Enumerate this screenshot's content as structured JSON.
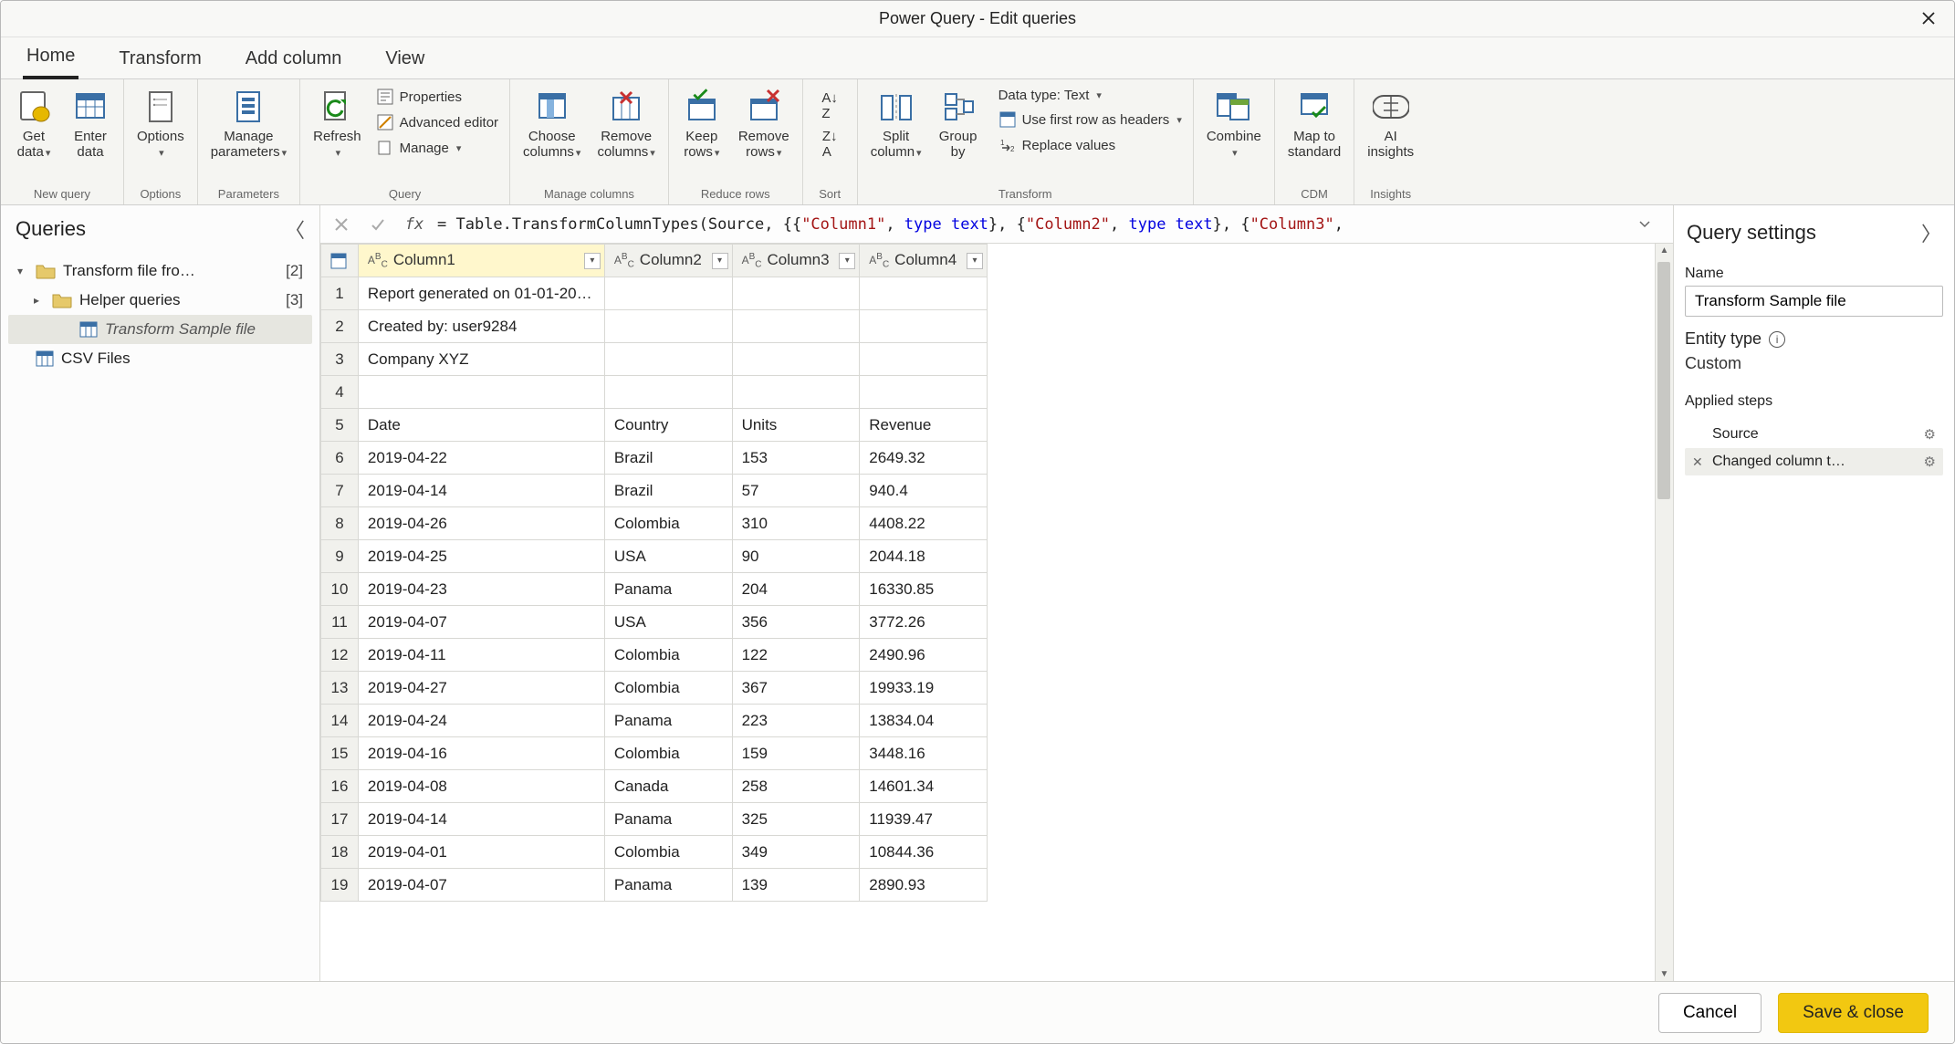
{
  "window_title": "Power Query - Edit queries",
  "maintabs": [
    "Home",
    "Transform",
    "Add column",
    "View"
  ],
  "maintab_active": 0,
  "ribbon": {
    "groups": [
      {
        "name": "New query",
        "big": [
          {
            "id": "get-data",
            "text": "Get\ndata",
            "chev": true
          },
          {
            "id": "enter-data",
            "text": "Enter\ndata"
          }
        ]
      },
      {
        "name": "Options",
        "big": [
          {
            "id": "options",
            "text": "Options",
            "chev": true
          }
        ]
      },
      {
        "name": "Parameters",
        "big": [
          {
            "id": "manage-params",
            "text": "Manage\nparameters",
            "chev": true
          }
        ]
      },
      {
        "name": "Query",
        "big": [
          {
            "id": "refresh",
            "text": "Refresh",
            "chev": true
          }
        ],
        "small": [
          {
            "id": "properties",
            "text": "Properties"
          },
          {
            "id": "adv-editor",
            "text": "Advanced editor"
          },
          {
            "id": "manage",
            "text": "Manage",
            "chev": true
          }
        ]
      },
      {
        "name": "Manage columns",
        "big": [
          {
            "id": "choose-cols",
            "text": "Choose\ncolumns",
            "chev": true
          },
          {
            "id": "remove-cols",
            "text": "Remove\ncolumns",
            "chev": true
          }
        ]
      },
      {
        "name": "Reduce rows",
        "big": [
          {
            "id": "keep-rows",
            "text": "Keep\nrows",
            "chev": true
          },
          {
            "id": "remove-rows",
            "text": "Remove\nrows",
            "chev": true
          }
        ]
      },
      {
        "name": "Sort",
        "big": [
          {
            "id": "sort",
            "text": ""
          }
        ]
      },
      {
        "name": "Transform",
        "big": [
          {
            "id": "split-col",
            "text": "Split\ncolumn",
            "chev": true
          },
          {
            "id": "group-by",
            "text": "Group\nby"
          }
        ],
        "small": [
          {
            "id": "data-type",
            "text": "Data type: Text",
            "chev": true
          },
          {
            "id": "first-row",
            "text": "Use first row as headers",
            "chev": true
          },
          {
            "id": "replace-vals",
            "text": "Replace values"
          }
        ]
      },
      {
        "name": "",
        "big": [
          {
            "id": "combine",
            "text": "Combine",
            "chev": true
          }
        ]
      },
      {
        "name": "CDM",
        "big": [
          {
            "id": "map-std",
            "text": "Map to\nstandard"
          }
        ]
      },
      {
        "name": "Insights",
        "big": [
          {
            "id": "ai-insights",
            "text": "AI\ninsights"
          }
        ]
      }
    ]
  },
  "queries": {
    "header": "Queries",
    "items": [
      {
        "id": "folder-transform",
        "label": "Transform file fro…",
        "count": "[2]",
        "type": "folder",
        "collapsed": false,
        "indent": 0,
        "caret": "down"
      },
      {
        "id": "folder-helper",
        "label": "Helper queries",
        "count": "[3]",
        "type": "folder",
        "collapsed": true,
        "indent": 1,
        "caret": "right"
      },
      {
        "id": "q-transform-sample",
        "label": "Transform Sample file",
        "type": "query",
        "indent": 2,
        "italic": true,
        "selected": true
      },
      {
        "id": "q-csv",
        "label": "CSV Files",
        "type": "query",
        "indent": 0,
        "caret": null
      }
    ]
  },
  "formula_prefix": "=  ",
  "formula_tokens": [
    {
      "t": "Table.TransformColumnTypes",
      "c": "fn"
    },
    {
      "t": "(Source, {{",
      "c": ""
    },
    {
      "t": "\"Column1\"",
      "c": "str"
    },
    {
      "t": ", ",
      "c": ""
    },
    {
      "t": "type text",
      "c": "kw"
    },
    {
      "t": "}, {",
      "c": ""
    },
    {
      "t": "\"Column2\"",
      "c": "str"
    },
    {
      "t": ", ",
      "c": ""
    },
    {
      "t": "type text",
      "c": "kw"
    },
    {
      "t": "}, {",
      "c": ""
    },
    {
      "t": "\"Column3\"",
      "c": "str"
    },
    {
      "t": ",",
      "c": ""
    }
  ],
  "table": {
    "columns": [
      "Column1",
      "Column2",
      "Column3",
      "Column4"
    ],
    "selected_col": 0,
    "rows": [
      [
        "Report generated on 01-01-20…",
        "",
        "",
        ""
      ],
      [
        "Created by: user9284",
        "",
        "",
        ""
      ],
      [
        "Company XYZ",
        "",
        "",
        ""
      ],
      [
        "",
        "",
        "",
        ""
      ],
      [
        "Date",
        "Country",
        "Units",
        "Revenue"
      ],
      [
        "2019-04-22",
        "Brazil",
        "153",
        "2649.32"
      ],
      [
        "2019-04-14",
        "Brazil",
        "57",
        "940.4"
      ],
      [
        "2019-04-26",
        "Colombia",
        "310",
        "4408.22"
      ],
      [
        "2019-04-25",
        "USA",
        "90",
        "2044.18"
      ],
      [
        "2019-04-23",
        "Panama",
        "204",
        "16330.85"
      ],
      [
        "2019-04-07",
        "USA",
        "356",
        "3772.26"
      ],
      [
        "2019-04-11",
        "Colombia",
        "122",
        "2490.96"
      ],
      [
        "2019-04-27",
        "Colombia",
        "367",
        "19933.19"
      ],
      [
        "2019-04-24",
        "Panama",
        "223",
        "13834.04"
      ],
      [
        "2019-04-16",
        "Colombia",
        "159",
        "3448.16"
      ],
      [
        "2019-04-08",
        "Canada",
        "258",
        "14601.34"
      ],
      [
        "2019-04-14",
        "Panama",
        "325",
        "11939.47"
      ],
      [
        "2019-04-01",
        "Colombia",
        "349",
        "10844.36"
      ],
      [
        "2019-04-07",
        "Panama",
        "139",
        "2890.93"
      ]
    ]
  },
  "settings": {
    "header": "Query settings",
    "name_label": "Name",
    "name_value": "Transform Sample file",
    "entity_type_label": "Entity type",
    "entity_type_value": "Custom",
    "applied_label": "Applied steps",
    "steps": [
      {
        "label": "Source",
        "gear": true,
        "selected": false,
        "x": false
      },
      {
        "label": "Changed column t…",
        "gear": true,
        "selected": true,
        "x": true
      }
    ]
  },
  "footer": {
    "cancel": "Cancel",
    "save": "Save & close"
  }
}
